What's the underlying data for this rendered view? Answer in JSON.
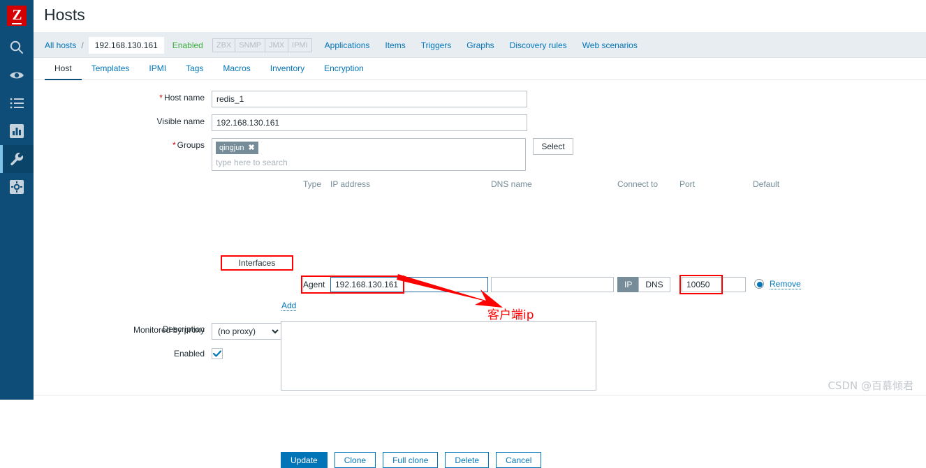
{
  "app": {
    "logo_letter": "Z",
    "page_title": "Hosts"
  },
  "sidebar": {
    "items": [
      {
        "name": "search",
        "icon": "search-icon",
        "active": false
      },
      {
        "name": "monitoring",
        "icon": "eye-icon",
        "active": false
      },
      {
        "name": "inventory",
        "icon": "list-icon",
        "active": false
      },
      {
        "name": "reports",
        "icon": "chart-icon",
        "active": false
      },
      {
        "name": "configuration",
        "icon": "wrench-icon",
        "active": true
      },
      {
        "name": "administration",
        "icon": "gear-icon",
        "active": false
      }
    ]
  },
  "breadcrumb": {
    "all_hosts": "All hosts",
    "separator": "/",
    "host": "192.168.130.161",
    "status": "Enabled",
    "protocols": [
      "ZBX",
      "SNMP",
      "JMX",
      "IPMI"
    ],
    "links": [
      "Applications",
      "Items",
      "Triggers",
      "Graphs",
      "Discovery rules",
      "Web scenarios"
    ]
  },
  "tabs": [
    {
      "label": "Host",
      "active": true
    },
    {
      "label": "Templates",
      "active": false
    },
    {
      "label": "IPMI",
      "active": false
    },
    {
      "label": "Tags",
      "active": false
    },
    {
      "label": "Macros",
      "active": false
    },
    {
      "label": "Inventory",
      "active": false
    },
    {
      "label": "Encryption",
      "active": false
    }
  ],
  "form": {
    "host_name": {
      "label": "Host name",
      "required": true,
      "value": "redis_1"
    },
    "visible_name": {
      "label": "Visible name",
      "required": false,
      "value": "192.168.130.161"
    },
    "groups": {
      "label": "Groups",
      "required": true,
      "chips": [
        "qingjun"
      ],
      "chip_remove": "✖",
      "placeholder": "type here to search",
      "select_button": "Select"
    },
    "interfaces": {
      "label": "Interfaces",
      "headers": {
        "type": "Type",
        "ip_address": "IP address",
        "dns_name": "DNS name",
        "connect_to": "Connect to",
        "port": "Port",
        "default": "Default"
      },
      "rows": [
        {
          "type": "Agent",
          "ip": "192.168.130.161",
          "dns": "",
          "dns_placeholder": "",
          "connect_to": "IP",
          "connect_options": [
            "IP",
            "DNS"
          ],
          "port": "10050",
          "default_selected": true,
          "remove_label": "Remove"
        }
      ],
      "add_label": "Add"
    },
    "description": {
      "label": "Description",
      "value": ""
    },
    "monitored_by_proxy": {
      "label": "Monitored by proxy",
      "value": "(no proxy)",
      "options": [
        "(no proxy)"
      ]
    },
    "enabled": {
      "label": "Enabled",
      "checked": true
    }
  },
  "buttons": {
    "update": "Update",
    "clone": "Clone",
    "full_clone": "Full clone",
    "delete": "Delete",
    "cancel": "Cancel"
  },
  "annotations": {
    "client_ip_note": "客户端ip",
    "highlight_color": "#ff0000"
  },
  "watermark": "CSDN @百慕倾君"
}
